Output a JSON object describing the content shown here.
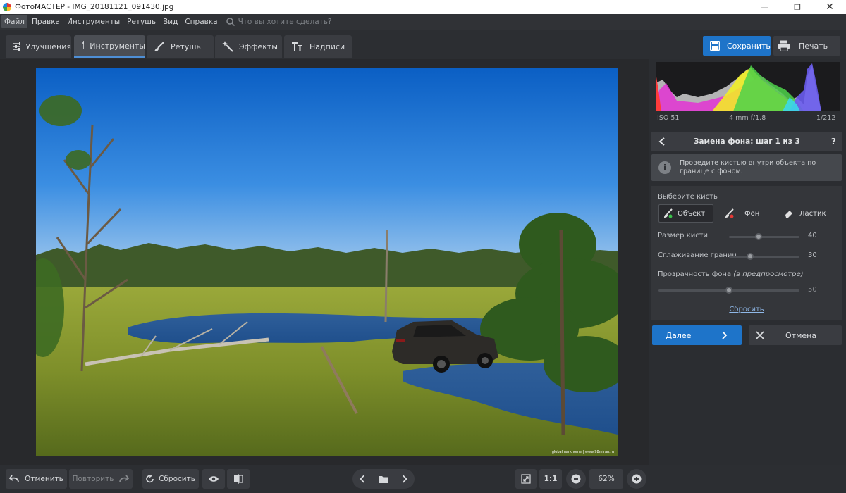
{
  "window": {
    "title": "ФотоМАСТЕР - IMG_20181121_091430.jpg"
  },
  "menu": {
    "items": [
      "Файл",
      "Правка",
      "Инструменты",
      "Ретушь",
      "Вид",
      "Справка"
    ],
    "search_placeholder": "Что вы хотите сделать?"
  },
  "tabs": [
    "Улучшения",
    "Инструменты",
    "Ретушь",
    "Эффекты",
    "Надписи"
  ],
  "toolbar": {
    "save_label": "Сохранить",
    "print_label": "Печать"
  },
  "photo": {
    "watermark": "globalmarkhome | www.98miran.ru"
  },
  "exif": {
    "iso": "ISO 51",
    "lens": "4 mm f/1.8",
    "index": "1/212"
  },
  "panel": {
    "step_title": "Замена фона: шаг 1 из 3",
    "help": "?",
    "hint": "Проведите кистью внутри объекта по границе с фоном.",
    "choose_brush": "Выберите кисть",
    "brushes": [
      "Объект",
      "Фон",
      "Ластик"
    ],
    "sliders": {
      "size": {
        "label": "Размер кисти",
        "value": "40",
        "fraction": 0.42
      },
      "smooth": {
        "label": "Сглаживание границ",
        "value": "30",
        "fraction": 0.3
      },
      "opacity": {
        "label": "Прозрачность фона",
        "label_em": "(в предпросмотре)",
        "value": "50",
        "fraction": 0.5
      }
    },
    "reset": "Сбросить",
    "next": "Далее",
    "cancel": "Отмена"
  },
  "bottom": {
    "undo": "Отменить",
    "redo": "Повторить",
    "reset": "Сбросить",
    "actual_size": "1:1",
    "zoom": "62%"
  },
  "colors": {
    "accent": "#1e74c9",
    "link": "#8fb8e8"
  }
}
